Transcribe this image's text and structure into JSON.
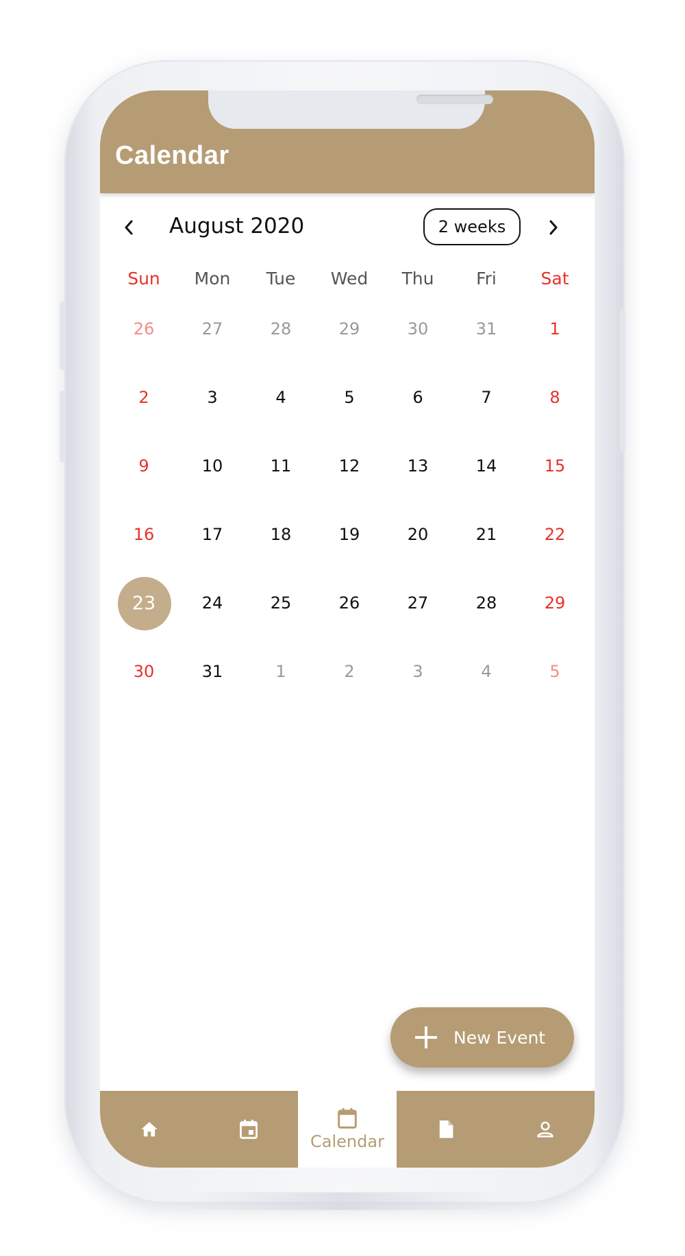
{
  "header": {
    "title": "Calendar"
  },
  "calendar": {
    "month_label": "August 2020",
    "range_toggle": "2 weeks",
    "weekdays": [
      "Sun",
      "Mon",
      "Tue",
      "Wed",
      "Thu",
      "Fri",
      "Sat"
    ],
    "weeks": [
      [
        "26",
        "27",
        "28",
        "29",
        "30",
        "31",
        "1"
      ],
      [
        "2",
        "3",
        "4",
        "5",
        "6",
        "7",
        "8"
      ],
      [
        "9",
        "10",
        "11",
        "12",
        "13",
        "14",
        "15"
      ],
      [
        "16",
        "17",
        "18",
        "19",
        "20",
        "21",
        "22"
      ],
      [
        "23",
        "24",
        "25",
        "26",
        "27",
        "28",
        "29"
      ],
      [
        "30",
        "31",
        "1",
        "2",
        "3",
        "4",
        "5"
      ]
    ],
    "selected_day": "23"
  },
  "fab": {
    "label": "New Event",
    "icon": "plus-icon"
  },
  "bottom_nav": {
    "items": [
      {
        "icon": "home-icon",
        "label": ""
      },
      {
        "icon": "event-icon",
        "label": ""
      },
      {
        "icon": "calendar-icon",
        "label": "Calendar",
        "active": true
      },
      {
        "icon": "document-icon",
        "label": ""
      },
      {
        "icon": "person-icon",
        "label": ""
      }
    ]
  },
  "colors": {
    "brand": "#b69c74",
    "today_circle": "#c4ad8b",
    "weekend": "#e8312a",
    "text": "#111111"
  }
}
